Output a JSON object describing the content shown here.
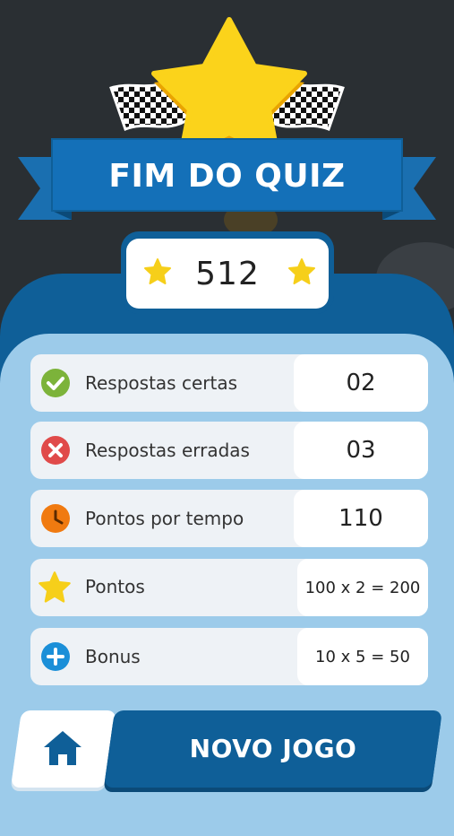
{
  "header": {
    "title": "FIM DO QUIZ"
  },
  "score": {
    "value": "512"
  },
  "rows": [
    {
      "label": "Respostas certas",
      "value": "02",
      "icon": "check-icon",
      "color": "#7cb33a"
    },
    {
      "label": "Respostas erradas",
      "value": "03",
      "icon": "x-icon",
      "color": "#e04a4a"
    },
    {
      "label": "Pontos por tempo",
      "value": "110",
      "icon": "clock-icon",
      "color": "#f07a10"
    },
    {
      "label": "Pontos",
      "value": "100 x 2  =  200",
      "icon": "star-icon",
      "color": "#f6cf1a"
    },
    {
      "label": "Bonus",
      "value": "10 x 5  =  50",
      "icon": "plus-icon",
      "color": "#1b8fd8"
    }
  ],
  "buttons": {
    "home_icon": "home-icon",
    "new_game": "NOVO JOGO"
  },
  "colors": {
    "background": "#2a2f33",
    "primary_blue": "#0f5f98",
    "light_blue": "#9ccbea",
    "star_yellow": "#f6cf1a"
  }
}
